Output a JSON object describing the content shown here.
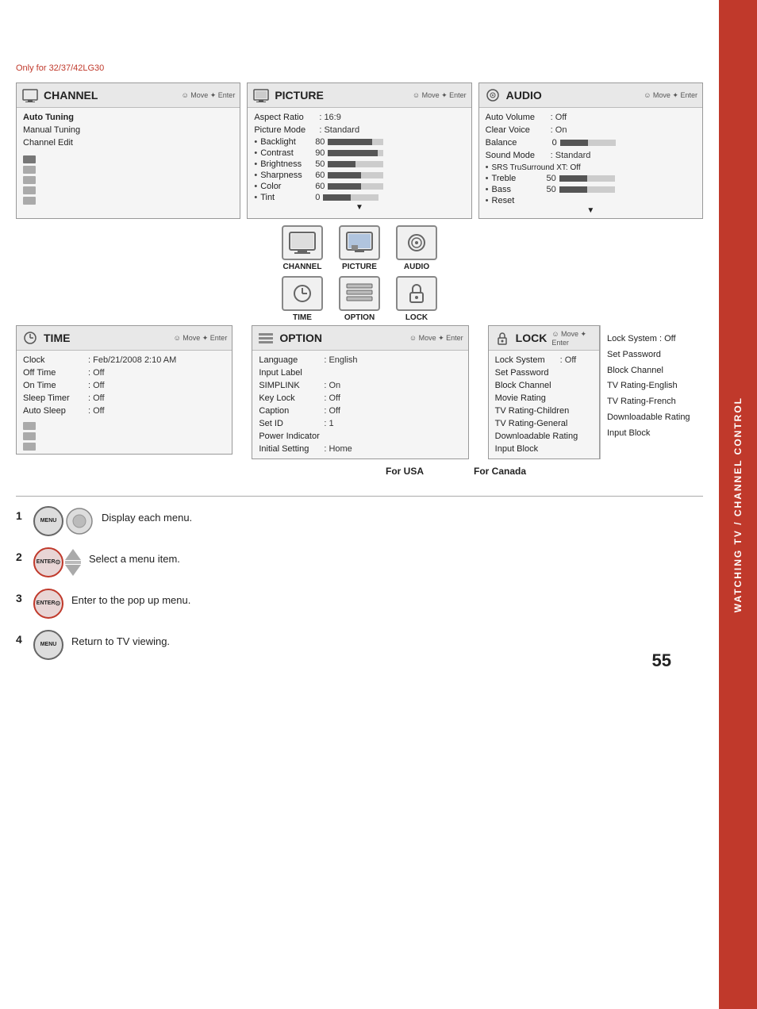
{
  "page": {
    "only_for_label": "Only for 32/37/42LG30",
    "page_number": "55",
    "sidebar_text": "WATCHING TV / CHANNEL CONTROL"
  },
  "channel_panel": {
    "title": "CHANNEL",
    "nav_hint": "Move  Enter",
    "items": [
      {
        "label": "Auto Tuning",
        "value": ""
      },
      {
        "label": "Manual Tuning",
        "value": ""
      },
      {
        "label": "Channel Edit",
        "value": ""
      }
    ]
  },
  "picture_panel": {
    "title": "PICTURE",
    "nav_hint": "Move  Enter",
    "aspect_ratio": {
      "label": "Aspect Ratio",
      "value": ": 16:9"
    },
    "picture_mode": {
      "label": "Picture Mode",
      "value": ": Standard"
    },
    "sub_items": [
      {
        "bullet": "•",
        "label": "Backlight",
        "value": "80",
        "bar_pct": 80
      },
      {
        "bullet": "•",
        "label": "Contrast",
        "value": "90",
        "bar_pct": 90
      },
      {
        "bullet": "•",
        "label": "Brightness",
        "value": "50",
        "bar_pct": 50
      },
      {
        "bullet": "•",
        "label": "Sharpness",
        "value": "60",
        "bar_pct": 60
      },
      {
        "bullet": "•",
        "label": "Color",
        "value": "60",
        "bar_pct": 60
      },
      {
        "bullet": "•",
        "label": "Tint",
        "value": "0",
        "bar_pct": 50,
        "center": true
      }
    ]
  },
  "audio_panel": {
    "title": "AUDIO",
    "nav_hint": "Move  Enter",
    "items": [
      {
        "label": "Auto Volume",
        "value": ": Off"
      },
      {
        "label": "Clear Voice",
        "value": ": On"
      },
      {
        "label": "Balance",
        "value": "0",
        "bar_pct": 50,
        "center": true
      },
      {
        "label": "Sound Mode",
        "value": ": Standard"
      }
    ],
    "sub_items": [
      {
        "bullet": "•",
        "label": "SRS TruSurround XT: Off"
      },
      {
        "bullet": "•",
        "label": "Treble",
        "value": "50",
        "bar_pct": 50
      },
      {
        "bullet": "•",
        "label": "Bass",
        "value": "50",
        "bar_pct": 50
      },
      {
        "bullet": "•",
        "label": "Reset"
      }
    ]
  },
  "time_panel": {
    "title": "TIME",
    "nav_hint": "Move  Enter",
    "items": [
      {
        "label": "Clock",
        "value": ": Feb/21/2008 2:10 AM"
      },
      {
        "label": "Off Time",
        "value": ": Off"
      },
      {
        "label": "On Time",
        "value": ": Off"
      },
      {
        "label": "Sleep Timer",
        "value": ": Off"
      },
      {
        "label": "Auto Sleep",
        "value": ": Off"
      }
    ]
  },
  "option_panel": {
    "title": "OPTION",
    "nav_hint": "Move  Enter",
    "items": [
      {
        "label": "Language",
        "value": ": English"
      },
      {
        "label": "Input Label",
        "value": ""
      },
      {
        "label": "SIMPLINK",
        "value": ": On"
      },
      {
        "label": "Key Lock",
        "value": ": Off"
      },
      {
        "label": "Caption",
        "value": ": Off"
      },
      {
        "label": "Set ID",
        "value": ": 1"
      },
      {
        "label": "Power Indicator",
        "value": ""
      },
      {
        "label": "Initial Setting",
        "value": ": Home"
      }
    ]
  },
  "lock_panel": {
    "title": "LOCK",
    "nav_hint": "Move  Enter",
    "usa_label": "For USA",
    "canada_label": "For Canada",
    "items": [
      {
        "label": "Lock System",
        "value": ": Off"
      },
      {
        "label": "Set Password",
        "value": ""
      },
      {
        "label": "Block Channel",
        "value": ""
      },
      {
        "label": "Movie Rating",
        "value": ""
      },
      {
        "label": "TV Rating-Children",
        "value": ""
      },
      {
        "label": "TV Rating-General",
        "value": ""
      },
      {
        "label": "Downloadable Rating",
        "value": ""
      },
      {
        "label": "Input Block",
        "value": ""
      }
    ],
    "canada_items": [
      "Lock System    : Off",
      "Set Password",
      "Block Channel",
      "TV Rating-English",
      "TV Rating-French",
      "Downloadable Rating",
      "Input Block"
    ]
  },
  "center_icons": {
    "row1": [
      {
        "label": "CHANNEL",
        "icon": "📺"
      },
      {
        "label": "PICTURE",
        "icon": "🖥"
      },
      {
        "label": "AUDIO",
        "icon": "🔊"
      }
    ],
    "row2": [
      {
        "label": "TIME",
        "icon": "🕐"
      },
      {
        "label": "OPTION",
        "icon": "⚙"
      },
      {
        "label": "LOCK",
        "icon": "🔒"
      }
    ]
  },
  "instructions": [
    {
      "number": "1",
      "buttons": [
        "MENU"
      ],
      "has_arrow": true,
      "text": "Display each menu."
    },
    {
      "number": "2",
      "buttons": [
        "ENTER"
      ],
      "has_nav_arrows": true,
      "text": "Select a menu item."
    },
    {
      "number": "3",
      "buttons": [
        "ENTER"
      ],
      "text": "Enter to the pop up menu."
    },
    {
      "number": "4",
      "buttons": [
        "MENU"
      ],
      "text": "Return to TV viewing."
    }
  ]
}
